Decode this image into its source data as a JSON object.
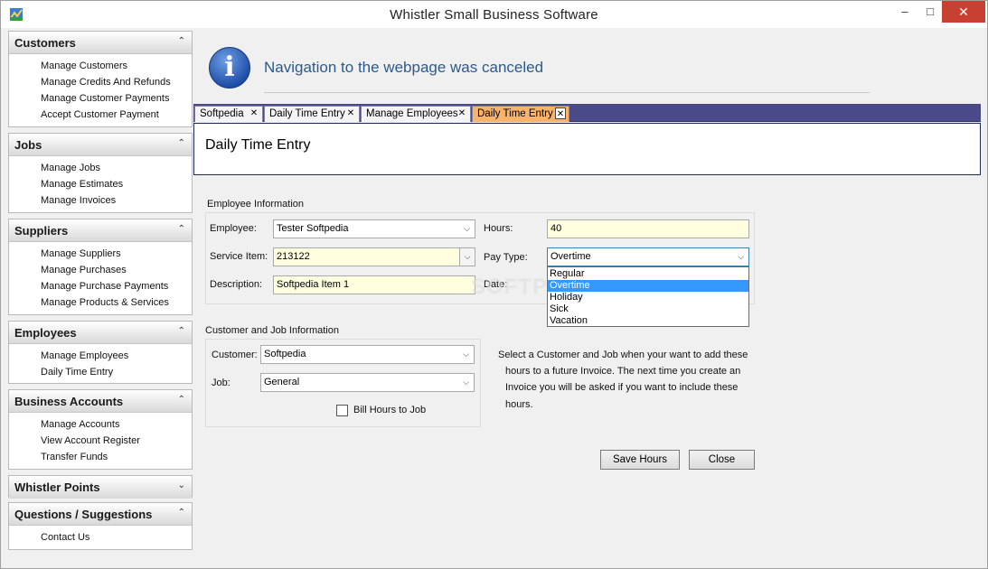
{
  "window": {
    "title": "Whistler Small  Business Software"
  },
  "sidebar": {
    "groups": [
      {
        "label": "Customers",
        "items": [
          "Manage Customers",
          "Manage Credits And Refunds",
          "Manage Customer Payments",
          "Accept Customer Payment"
        ]
      },
      {
        "label": "Jobs",
        "items": [
          "Manage Jobs",
          "Manage Estimates",
          "Manage Invoices"
        ]
      },
      {
        "label": "Suppliers",
        "items": [
          "Manage Suppliers",
          "Manage Purchases",
          "Manage Purchase Payments",
          "Manage Products & Services"
        ]
      },
      {
        "label": "Employees",
        "items": [
          "Manage Employees",
          "Daily Time Entry"
        ]
      },
      {
        "label": "Business Accounts",
        "items": [
          "Manage Accounts",
          "View Account Register",
          "Transfer Funds"
        ]
      },
      {
        "label": "Whistler Points",
        "items": []
      },
      {
        "label": "Questions / Suggestions",
        "items": [
          "Contact Us"
        ]
      }
    ]
  },
  "banner": {
    "message": "Navigation to the webpage was canceled"
  },
  "tabs": [
    {
      "label": "Softpedia",
      "active": false
    },
    {
      "label": "Daily Time Entry",
      "active": false
    },
    {
      "label": "Manage Employees",
      "active": false
    },
    {
      "label": "Daily Time Entry",
      "active": true
    }
  ],
  "page": {
    "title": "Daily Time Entry"
  },
  "employee_info": {
    "section_title": "Employee Information",
    "employee_label": "Employee:",
    "employee_value": "Tester Softpedia",
    "service_item_label": "Service Item:",
    "service_item_value": "213122",
    "description_label": "Description:",
    "description_value": "Softpedia Item 1",
    "hours_label": "Hours:",
    "hours_value": "40",
    "pay_type_label": "Pay Type:",
    "pay_type_value": "Overtime",
    "pay_type_options": [
      "Regular",
      "Overtime",
      "Holiday",
      "Sick",
      "Vacation"
    ],
    "pay_type_selected_index": 1,
    "date_label": "Date:"
  },
  "customer_info": {
    "section_title": "Customer and Job Information",
    "customer_label": "Customer:",
    "customer_value": "Softpedia",
    "job_label": "Job:",
    "job_value": "General",
    "bill_hours_label": "Bill Hours to Job",
    "bill_hours_checked": false,
    "help_lines": [
      "Select a Customer and Job when your want to add these",
      "hours to a future Invoice. The next time you create an",
      "Invoice you will be asked if you want to include these",
      "hours."
    ]
  },
  "buttons": {
    "save_hours": "Save Hours",
    "close": "Close"
  },
  "watermark": "SOFTPEDIA",
  "colors": {
    "active_tab": "#fbb36a",
    "tabstrip": "#4a4a88",
    "banner_text": "#2c5a8c",
    "field_yellow": "#ffffe0",
    "dropdown_selected": "#3399ff",
    "close_button": "#c84031"
  }
}
